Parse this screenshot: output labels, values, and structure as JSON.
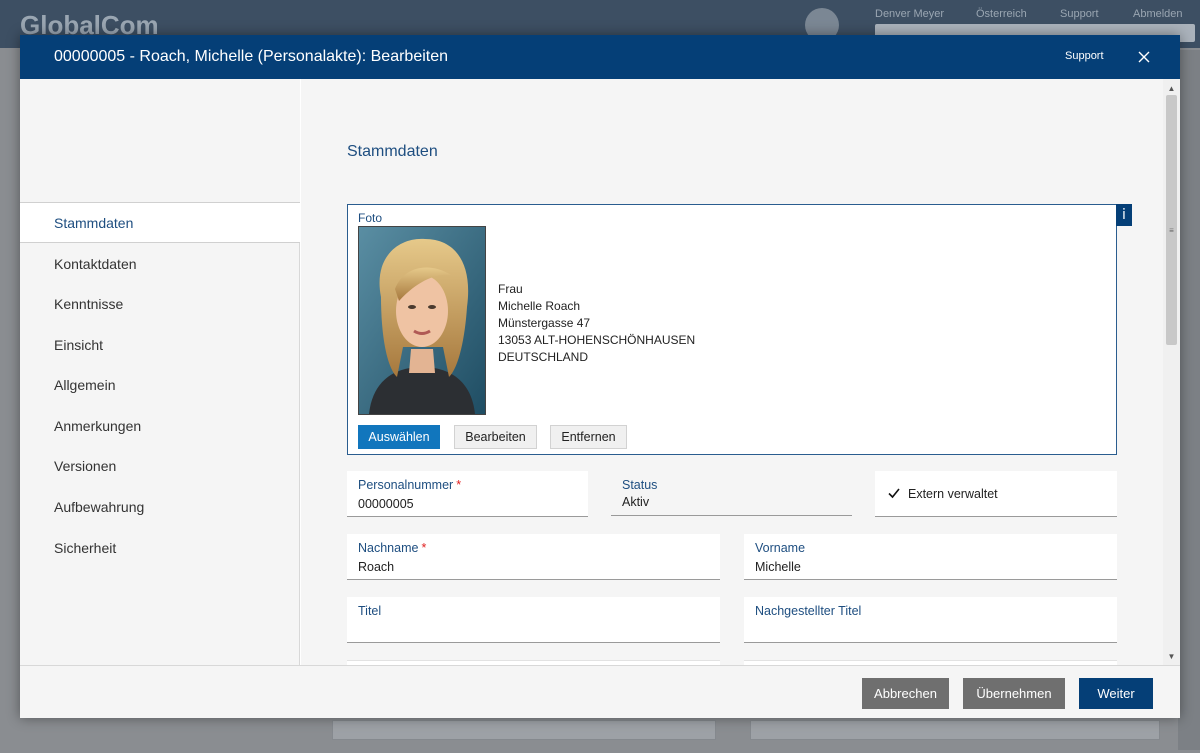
{
  "background": {
    "logo_text": "GlobalCom",
    "nav": [
      "Denver Meyer",
      "Österreich",
      "Support",
      "Abmelden"
    ]
  },
  "modal": {
    "title": "00000005 - Roach, Michelle (Personalakte): Bearbeiten",
    "support_label": "Support",
    "close_icon": "close-icon"
  },
  "left_nav": {
    "items": [
      {
        "label": "Stammdaten",
        "active": true
      },
      {
        "label": "Kontaktdaten",
        "active": false
      },
      {
        "label": "Kenntnisse",
        "active": false
      },
      {
        "label": "Einsicht",
        "active": false
      },
      {
        "label": "Allgemein",
        "active": false
      },
      {
        "label": "Anmerkungen",
        "active": false
      },
      {
        "label": "Versionen",
        "active": false
      },
      {
        "label": "Aufbewahrung",
        "active": false
      },
      {
        "label": "Sicherheit",
        "active": false
      }
    ]
  },
  "content": {
    "section_title": "Stammdaten",
    "foto": {
      "label": "Foto",
      "info_label": "i",
      "address_lines": [
        "Frau",
        "Michelle Roach",
        "Münstergasse 47",
        "13053 ALT-HOHENSCHÖNHAUSEN",
        "DEUTSCHLAND"
      ],
      "buttons": {
        "select": "Auswählen",
        "edit": "Bearbeiten",
        "remove": "Entfernen"
      }
    },
    "fields": {
      "personalnummer": {
        "label": "Personalnummer",
        "required_mark": "*",
        "value": "00000005"
      },
      "status": {
        "label": "Status",
        "value": "Aktiv"
      },
      "extern": {
        "label": "Extern verwaltet",
        "checked": true
      },
      "nachname": {
        "label": "Nachname",
        "required_mark": "*",
        "value": "Roach"
      },
      "vorname": {
        "label": "Vorname",
        "value": "Michelle"
      },
      "titel": {
        "label": "Titel",
        "value": ""
      },
      "nachgestellter_titel": {
        "label": "Nachgestellter Titel",
        "value": ""
      }
    }
  },
  "footer": {
    "cancel": "Abbrechen",
    "apply": "Übernehmen",
    "next": "Weiter"
  },
  "colors": {
    "header": "#053f77",
    "primary_button": "#1176bd",
    "label": "#1e4e80",
    "required": "#e02020"
  }
}
